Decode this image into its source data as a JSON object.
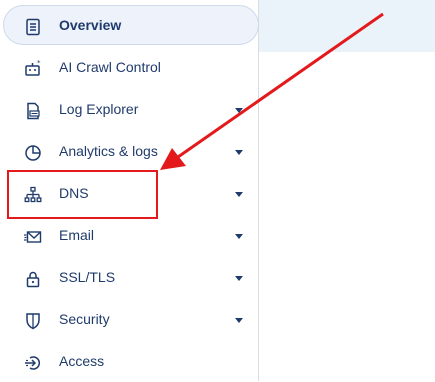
{
  "sidebar": {
    "items": [
      {
        "label": "Overview",
        "icon": "document-list-icon",
        "has_chevron": false,
        "active": true
      },
      {
        "label": "AI Crawl Control",
        "icon": "robot-icon",
        "has_chevron": false,
        "active": false
      },
      {
        "label": "Log Explorer",
        "icon": "log-document-icon",
        "has_chevron": true,
        "active": false
      },
      {
        "label": "Analytics & logs",
        "icon": "pie-chart-icon",
        "has_chevron": true,
        "active": false
      },
      {
        "label": "DNS",
        "icon": "network-tree-icon",
        "has_chevron": true,
        "active": false
      },
      {
        "label": "Email",
        "icon": "envelope-icon",
        "has_chevron": true,
        "active": false
      },
      {
        "label": "SSL/TLS",
        "icon": "lock-icon",
        "has_chevron": true,
        "active": false
      },
      {
        "label": "Security",
        "icon": "shield-icon",
        "has_chevron": true,
        "active": false
      },
      {
        "label": "Access",
        "icon": "access-arrow-icon",
        "has_chevron": false,
        "active": false
      }
    ]
  },
  "annotation": {
    "highlight_color": "#e3191b",
    "highlighted_item": "DNS"
  },
  "colors": {
    "text": "#1f3b6b",
    "active_bg": "#eef3fb",
    "main_top_bg": "#eaf3fa"
  }
}
